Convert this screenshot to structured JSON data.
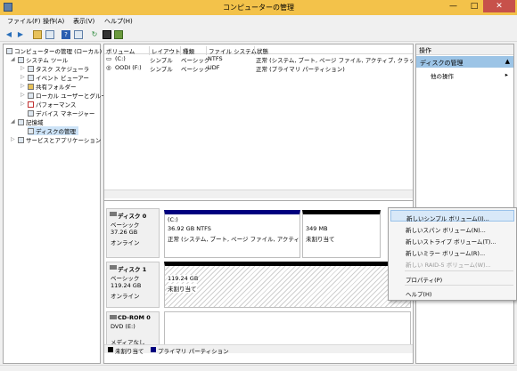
{
  "window": {
    "title": "コンピューターの管理",
    "title_bar_color": "#f3c24a",
    "minimize_glyph": "—",
    "maximize_glyph": "□",
    "close_glyph": "✕"
  },
  "menu": [
    "ファイル(F)",
    "操作(A)",
    "表示(V)",
    "ヘルプ(H)"
  ],
  "toolbar_icons": [
    "back-icon",
    "forward-icon",
    "up-folder-icon",
    "show-tree-icon",
    "help-icon",
    "properties-icon",
    "refresh-icon",
    "export-icon",
    "settings-icon"
  ],
  "tree": {
    "root": "コンピューターの管理 (ローカル)",
    "items": [
      {
        "label": "システム ツール",
        "level": 1,
        "expanded": true
      },
      {
        "label": "タスク スケジューラ",
        "level": 2
      },
      {
        "label": "イベント ビューアー",
        "level": 2
      },
      {
        "label": "共有フォルダー",
        "level": 2
      },
      {
        "label": "ローカル ユーザーとグループ",
        "level": 2
      },
      {
        "label": "パフォーマンス",
        "level": 2
      },
      {
        "label": "デバイス マネージャー",
        "level": 2
      },
      {
        "label": "記憶域",
        "level": 1,
        "expanded": true
      },
      {
        "label": "ディスクの管理",
        "level": 2,
        "selected": true
      },
      {
        "label": "サービスとアプリケーション",
        "level": 1
      }
    ]
  },
  "volume_list": {
    "columns": [
      "ボリューム",
      "レイアウト",
      "種類",
      "ファイル システム",
      "状態"
    ],
    "rows": [
      [
        "(C:)",
        "シンプル",
        "ベーシック",
        "NTFS",
        "正常 (システム, ブート, ページ ファイル, アクティブ, クラッシュ ダンプ, プライマリ パーティション)"
      ],
      [
        "OODI (F:)",
        "シンプル",
        "ベーシック",
        "UDF",
        "正常 (プライマリ パーティション)"
      ]
    ]
  },
  "disks": [
    {
      "name": "ディスク 0",
      "type": "ベーシック",
      "size": "37.26 GB",
      "status": "オンライン",
      "partitions": [
        {
          "label": "(C:)",
          "size": "36.92 GB NTFS",
          "status": "正常 (システム, ブート, ページ ファイル, アクティブ, クラッシュ",
          "bar_color": "#00007f"
        },
        {
          "label": "",
          "size": "349 MB",
          "status": "未割り当て",
          "bar_color": "#000000"
        }
      ]
    },
    {
      "name": "ディスク 1",
      "type": "ベーシック",
      "size": "119.24 GB",
      "status": "オンライン",
      "partitions": [
        {
          "label": "",
          "size": "119.24 GB",
          "status": "未割り当て",
          "bar_color": "#000000"
        }
      ]
    },
    {
      "name": "CD-ROM 0",
      "type": "DVD (E:)",
      "size": "",
      "status": "メディアなし",
      "partitions": []
    }
  ],
  "legend": [
    {
      "label": "未割り当て",
      "color": "#000000"
    },
    {
      "label": "プライマリ パーティション",
      "color": "#00007f"
    }
  ],
  "operations": {
    "header": "操作",
    "section": "ディスクの管理",
    "action": "他の操作",
    "selection_color": "#9cc4e6"
  },
  "context_menu": [
    {
      "label": "新しいシンプル ボリューム(I)...",
      "state": "highlighted"
    },
    {
      "label": "新しいスパン ボリューム(N)...",
      "state": "enabled"
    },
    {
      "label": "新しいストライプ ボリューム(T)...",
      "state": "enabled"
    },
    {
      "label": "新しいミラー ボリューム(R)...",
      "state": "enabled"
    },
    {
      "label": "新しい RAID-5 ボリューム(W)...",
      "state": "disabled"
    },
    {
      "label": "プロパティ(P)",
      "state": "enabled"
    },
    {
      "label": "ヘルプ(H)",
      "state": "enabled"
    }
  ]
}
